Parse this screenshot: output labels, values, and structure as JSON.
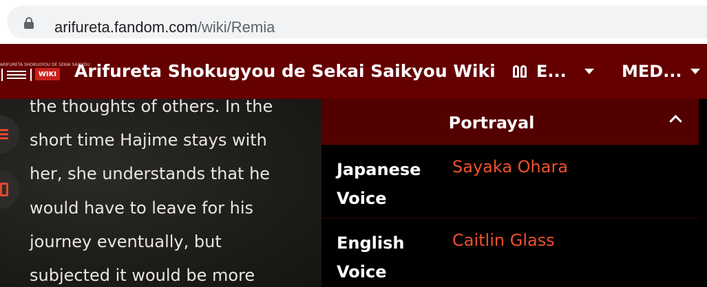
{
  "browser": {
    "url_host": "arifureta.fandom.com",
    "url_path": "/wiki/Remia"
  },
  "wiki_header": {
    "logo_topline": "ARIFURETA SHOKUGYOU DE SEKAI SAIKYOU",
    "logo_badge": "WIKI",
    "title": "Arifureta Shokugyou de Sekai Saikyou Wiki",
    "nav_explore": "E...",
    "nav_media": "MED..."
  },
  "article": {
    "lines": [
      "the thoughts of others. In the",
      "short time Hajime stays with",
      "her, she understands that he",
      "would have to leave for his",
      "journey eventually, but",
      "subjected it would be more"
    ]
  },
  "infobox": {
    "section_title": "Portrayal",
    "rows": [
      {
        "label_line1": "Japanese",
        "label_line2": "Voice",
        "value": "Sayaka Ohara"
      },
      {
        "label_line1": "English",
        "label_line2": "Voice",
        "value": "Caitlin Glass"
      }
    ]
  },
  "colors": {
    "header_bg": "#650000",
    "section_header_bg": "#530000",
    "link": "#f0502d",
    "accent": "#e5462f"
  },
  "icons": [
    "lock-icon",
    "explore-icon",
    "chevron-down-icon",
    "list-icon",
    "share-icon",
    "chevron-up-icon"
  ]
}
